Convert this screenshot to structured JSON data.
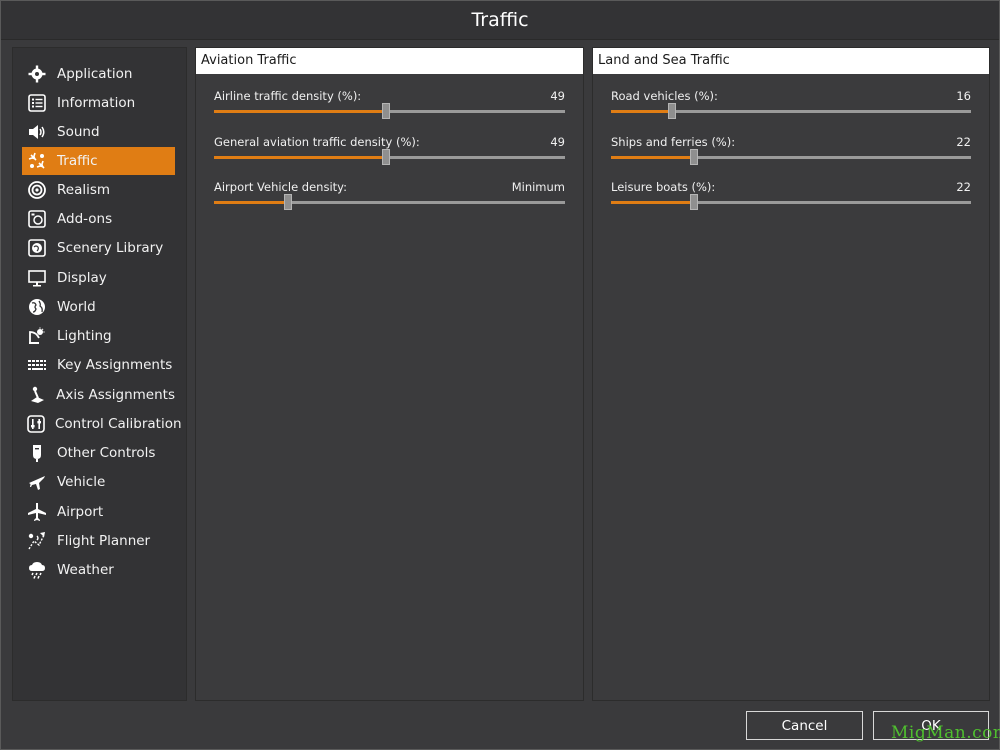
{
  "window": {
    "title": "Traffic"
  },
  "sidebar": {
    "items": [
      {
        "label": "Application",
        "icon": "gear-icon"
      },
      {
        "label": "Information",
        "icon": "list-icon"
      },
      {
        "label": "Sound",
        "icon": "speaker-icon"
      },
      {
        "label": "Traffic",
        "icon": "traffic-icon",
        "active": true
      },
      {
        "label": "Realism",
        "icon": "realism-icon"
      },
      {
        "label": "Add-ons",
        "icon": "addons-icon"
      },
      {
        "label": "Scenery Library",
        "icon": "scenery-icon"
      },
      {
        "label": "Display",
        "icon": "monitor-icon"
      },
      {
        "label": "World",
        "icon": "globe-icon"
      },
      {
        "label": "Lighting",
        "icon": "lighting-icon"
      },
      {
        "label": "Key Assignments",
        "icon": "keyboard-icon"
      },
      {
        "label": "Axis Assignments",
        "icon": "joystick-icon"
      },
      {
        "label": "Control Calibration",
        "icon": "calibration-icon"
      },
      {
        "label": "Other Controls",
        "icon": "controller-icon"
      },
      {
        "label": "Vehicle",
        "icon": "plane-icon"
      },
      {
        "label": "Airport",
        "icon": "airport-icon"
      },
      {
        "label": "Flight Planner",
        "icon": "flight-planner-icon"
      },
      {
        "label": "Weather",
        "icon": "weather-icon"
      }
    ]
  },
  "aviation": {
    "title": "Aviation Traffic",
    "settings": [
      {
        "label": "Airline traffic density (%):",
        "value": "49",
        "fraction": 0.49
      },
      {
        "label": "General aviation traffic density (%):",
        "value": "49",
        "fraction": 0.49
      },
      {
        "label": "Airport Vehicle density:",
        "value": "Minimum",
        "fraction": 0.21
      }
    ]
  },
  "land_sea": {
    "title": "Land and Sea Traffic",
    "settings": [
      {
        "label": "Road vehicles (%):",
        "value": "16",
        "fraction": 0.17
      },
      {
        "label": "Ships and ferries (%):",
        "value": "22",
        "fraction": 0.23
      },
      {
        "label": "Leisure boats (%):",
        "value": "22",
        "fraction": 0.23
      }
    ]
  },
  "buttons": {
    "cancel": "Cancel",
    "ok": "OK"
  },
  "watermark": "MigMan.com",
  "colors": {
    "accent": "#e07d14",
    "background": "#3a3a3c",
    "panel_header": "#ffffff"
  }
}
